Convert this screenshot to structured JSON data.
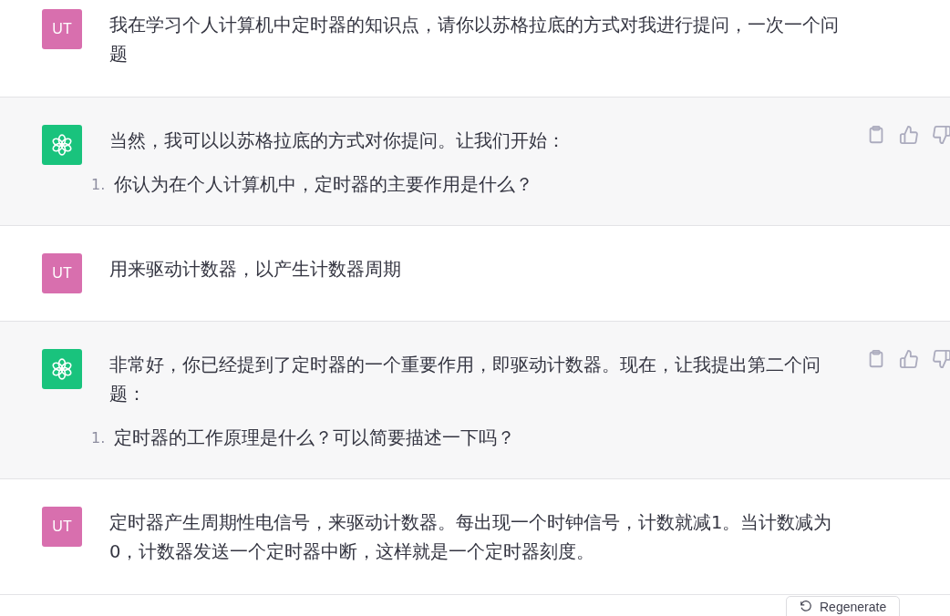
{
  "messages": [
    {
      "kind": "user",
      "avatar": "UT",
      "blocks": [
        {
          "kind": "paragraph",
          "text": "我在学习个人计算机中定时器的知识点，请你以苏格拉底的方式对我进行提问，一次一个问题"
        }
      ]
    },
    {
      "kind": "assistant",
      "blocks": [
        {
          "kind": "paragraph",
          "text": "当然，我可以以苏格拉底的方式对你提问。让我们开始："
        },
        {
          "kind": "list",
          "items": [
            {
              "number": "1.",
              "text": "你认为在个人计算机中，定时器的主要作用是什么？"
            }
          ]
        }
      ]
    },
    {
      "kind": "user",
      "avatar": "UT",
      "blocks": [
        {
          "kind": "paragraph",
          "text": "用来驱动计数器，以产生计数器周期"
        }
      ]
    },
    {
      "kind": "assistant",
      "blocks": [
        {
          "kind": "paragraph",
          "text": "非常好，你已经提到了定时器的一个重要作用，即驱动计数器。现在，让我提出第二个问题："
        },
        {
          "kind": "list",
          "items": [
            {
              "number": "1.",
              "text": "定时器的工作原理是什么？可以简要描述一下吗？"
            }
          ]
        }
      ]
    },
    {
      "kind": "user",
      "avatar": "UT",
      "blocks": [
        {
          "kind": "paragraph",
          "text": "定时器产生周期性电信号，来驱动计数器。每出现一个时钟信号，计数就减1。当计数减为0，计数器发送一个定时器中断，这样就是一个定时器刻度。"
        }
      ]
    }
  ],
  "regenerate_button": {
    "label": "Regenerate"
  }
}
